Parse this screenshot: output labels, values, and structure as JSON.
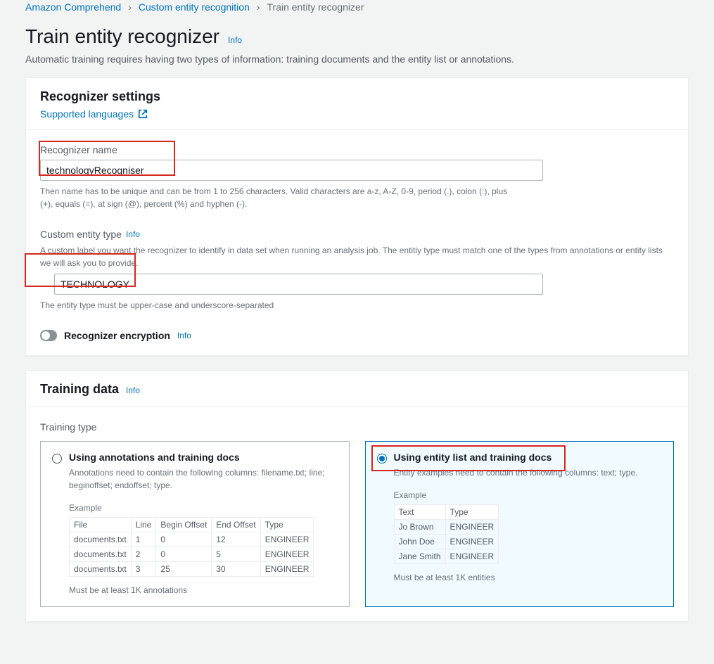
{
  "breadcrumb": {
    "items": [
      "Amazon Comprehend",
      "Custom entity recognition",
      "Train entity recognizer"
    ]
  },
  "header": {
    "title": "Train entity recognizer",
    "info": "Info",
    "subtitle": "Automatic training requires having two types of information: training documents and the entity list or annotations."
  },
  "settings": {
    "title": "Recognizer settings",
    "supported_languages": "Supported languages",
    "name": {
      "label": "Recognizer name",
      "value": "technologyRecogniser",
      "hint": "Then name has to be unique and can be from 1 to 256 characters. Valid characters are a-z, A-Z, 0-9, period (.), colon (:), plus (+), equals (=), at sign (@), percent (%) and hyphen (-)."
    },
    "entity_type": {
      "label": "Custom entity type",
      "info": "Info",
      "desc": "A custom label you want the recognizer to identify in data set when running an analysis job. The entitiy type must match one of the types from annotations or entity lists we will ask you to provide.",
      "value": "TECHNOLOGY",
      "hint": "The entity type must be upper-case and underscore-separated"
    },
    "encryption": {
      "label": "Recognizer encryption",
      "info": "Info"
    }
  },
  "training": {
    "title": "Training data",
    "info": "Info",
    "type_label": "Training type",
    "options": [
      {
        "title": "Using annotations and training docs",
        "desc": "Annotations need to contain the following columns: filename.txt; line; beginoffset; endoffset; type.",
        "example_label": "Example",
        "headers": [
          "File",
          "Line",
          "Begin Offset",
          "End Offset",
          "Type"
        ],
        "rows": [
          [
            "documents.txt",
            "1",
            "0",
            "12",
            "ENGINEER"
          ],
          [
            "documents.txt",
            "2",
            "0",
            "5",
            "ENGINEER"
          ],
          [
            "documents.txt",
            "3",
            "25",
            "30",
            "ENGINEER"
          ]
        ],
        "hint": "Must be at least 1K annotations"
      },
      {
        "title": "Using entity list and training docs",
        "desc": "Entity examples need to contain the following columns: text; type.",
        "example_label": "Example",
        "headers": [
          "Text",
          "Type"
        ],
        "rows": [
          [
            "Jo Brown",
            "ENGINEER"
          ],
          [
            "John Doe",
            "ENGINEER"
          ],
          [
            "Jane Smith",
            "ENGINEER"
          ]
        ],
        "hint": "Must be at least 1K entities"
      }
    ]
  }
}
